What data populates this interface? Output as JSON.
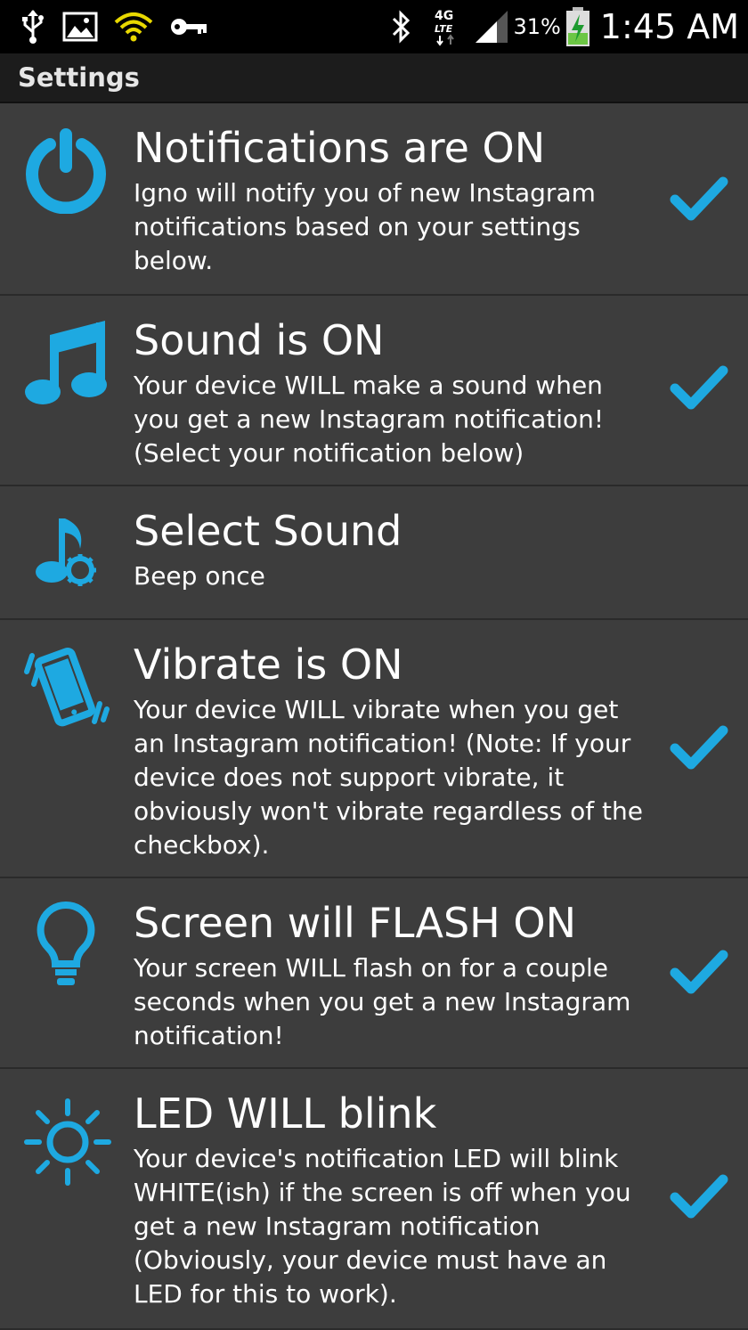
{
  "status_bar": {
    "battery_percent": "31%",
    "time": "1:45 AM",
    "network": "4G LTE",
    "icons": [
      "usb-icon",
      "image-icon",
      "wifi-icon",
      "key-icon",
      "bluetooth-icon",
      "lte-icon",
      "signal-icon",
      "battery-charging-icon"
    ]
  },
  "action_bar": {
    "title": "Settings"
  },
  "colors": {
    "accent": "#1ea9e1",
    "background": "#3d3d3d",
    "divider": "#2a2a2a"
  },
  "settings": [
    {
      "icon": "power-icon",
      "title": "Notifications are ON",
      "description": "Igno will notify you of new Instagram notifications based on your settings below.",
      "checked": true
    },
    {
      "icon": "music-note-icon",
      "title": "Sound is ON",
      "description": "Your device WILL make a sound when you get a new Instagram notification! (Select your notification below)",
      "checked": true
    },
    {
      "icon": "sound-settings-icon",
      "title": "Select Sound",
      "description": "Beep once"
    },
    {
      "icon": "vibrate-icon",
      "title": "Vibrate is ON",
      "description": "Your device WILL vibrate when you get an Instagram notification! (Note: If your device does not support vibrate, it obviously won't vibrate regardless of the checkbox).",
      "checked": true
    },
    {
      "icon": "lightbulb-icon",
      "title": "Screen will FLASH ON",
      "description": "Your screen WILL flash on for a couple seconds when you get a new Instagram notification!",
      "checked": true
    },
    {
      "icon": "sun-icon",
      "title": "LED WILL blink",
      "description": "Your device's notification LED will blink WHITE(ish) if the screen is off when you get a new Instagram notification (Obviously, your device must have an LED for this to work).",
      "checked": true
    }
  ]
}
